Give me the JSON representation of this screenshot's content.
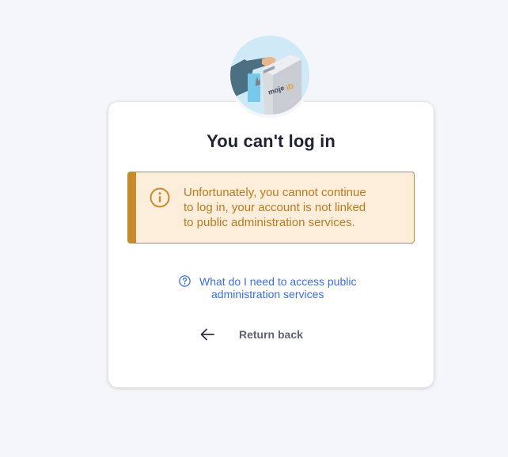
{
  "avatar": {
    "icon": "mojeid-machine-illustration",
    "brand_text": "mojeID"
  },
  "dialog": {
    "title": "You can't log in"
  },
  "alert": {
    "icon": "info-circle-icon",
    "line1": "Unfortunately, you cannot continue",
    "line2": "to log in, your account is not linked",
    "line3": "to public administration services.",
    "color": "#c98a2b",
    "background": "#fdeedb"
  },
  "help_link": {
    "icon": "question-circle-icon",
    "line1": "What do I need to access public",
    "line2": "administration services",
    "color": "#3b6fd8"
  },
  "back_button": {
    "icon": "arrow-left-icon",
    "label": "Return back"
  },
  "colors": {
    "page_background": "#f5f6f9",
    "title": "#1f2430"
  }
}
